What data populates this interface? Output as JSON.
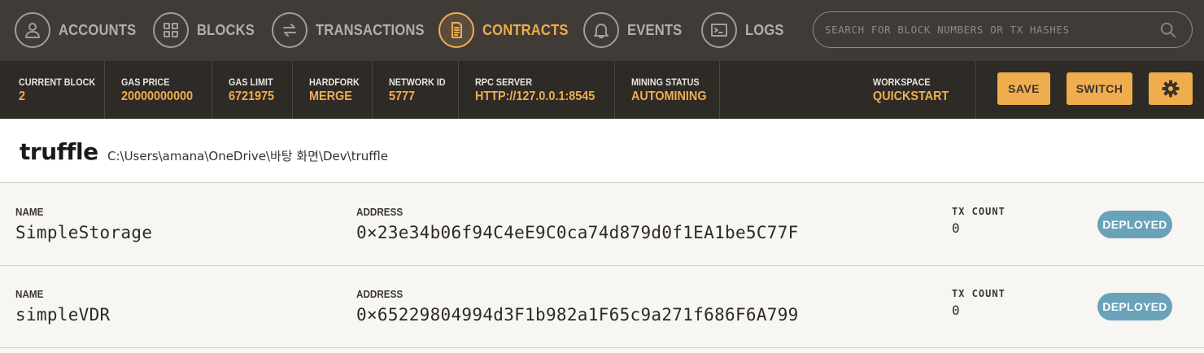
{
  "nav": {
    "items": [
      {
        "label": "ACCOUNTS",
        "icon": "account-icon",
        "active": false
      },
      {
        "label": "BLOCKS",
        "icon": "blocks-icon",
        "active": false
      },
      {
        "label": "TRANSACTIONS",
        "icon": "transactions-icon",
        "active": false
      },
      {
        "label": "CONTRACTS",
        "icon": "contracts-icon",
        "active": true
      },
      {
        "label": "EVENTS",
        "icon": "bell-icon",
        "active": false
      },
      {
        "label": "LOGS",
        "icon": "terminal-icon",
        "active": false
      }
    ],
    "search": {
      "placeholder": "SEARCH FOR BLOCK NUMBERS OR TX HASHES",
      "value": ""
    }
  },
  "status": {
    "current_block": {
      "label": "CURRENT BLOCK",
      "value": "2"
    },
    "gas_price": {
      "label": "GAS PRICE",
      "value": "20000000000"
    },
    "gas_limit": {
      "label": "GAS LIMIT",
      "value": "6721975"
    },
    "hardfork": {
      "label": "HARDFORK",
      "value": "MERGE"
    },
    "network_id": {
      "label": "NETWORK ID",
      "value": "5777"
    },
    "rpc_server": {
      "label": "RPC SERVER",
      "value": "HTTP://127.0.0.1:8545"
    },
    "mining_status": {
      "label": "MINING STATUS",
      "value": "AUTOMINING"
    },
    "workspace": {
      "label": "WORKSPACE",
      "value": "QUICKSTART"
    }
  },
  "actions": {
    "save_label": "SAVE",
    "switch_label": "SWITCH",
    "settings_icon": "gear-icon"
  },
  "project": {
    "name": "truffle",
    "path": "C:\\Users\\amana\\OneDrive\\바탕 화면\\Dev\\truffle"
  },
  "contracts": [
    {
      "name_label": "NAME",
      "name": "SimpleStorage",
      "address_label": "ADDRESS",
      "address": "0×23e34b06f94C4eE9C0ca74d879d0f1EA1be5C77F",
      "tx_label": "TX COUNT",
      "tx_count": "0",
      "status": "DEPLOYED"
    },
    {
      "name_label": "NAME",
      "name": "simpleVDR",
      "address_label": "ADDRESS",
      "address": "0×65229804994d3F1b982a1F65c9a271f686F6A799",
      "tx_label": "TX COUNT",
      "tx_count": "0",
      "status": "DEPLOYED"
    }
  ],
  "colors": {
    "accent": "#f0ad4e",
    "nav_bg": "#403b37",
    "status_bg": "#2e2a26",
    "badge": "#6aa2b9"
  }
}
